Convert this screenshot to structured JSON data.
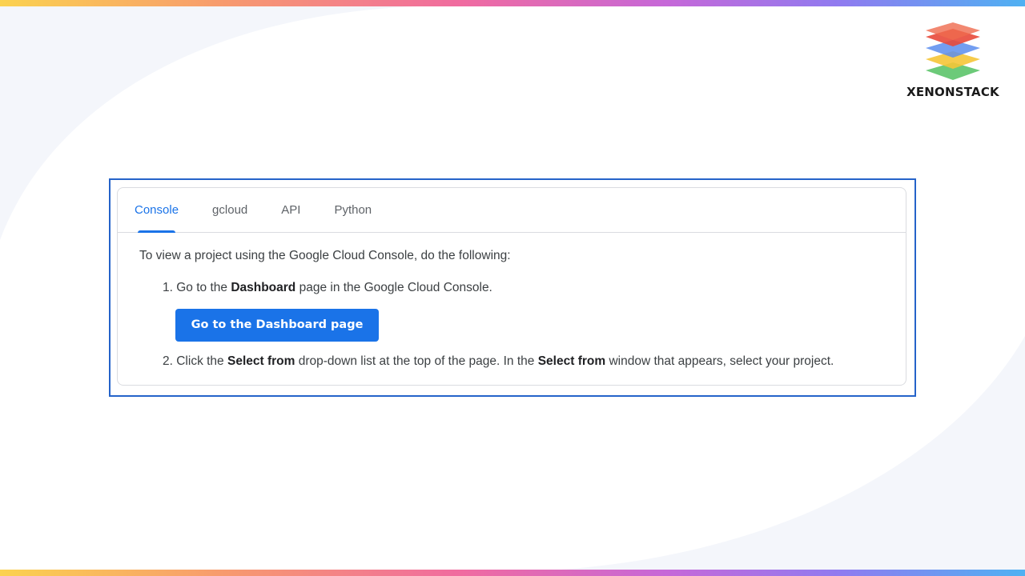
{
  "brand": {
    "name": "XENONSTACK",
    "logo_icon": "layered-stack-logo-icon",
    "layer_colors": [
      "#e8493a",
      "#5b8def",
      "#f5c537",
      "#5cc46a"
    ]
  },
  "decor": {
    "gradient_colors": [
      "#fbd24f",
      "#f79a6e",
      "#f06ba0",
      "#c668d8",
      "#8f7bf0",
      "#4fb1f2"
    ],
    "background_curve_color": "#f4f6fb"
  },
  "tabs": [
    {
      "label": "Console",
      "active": true
    },
    {
      "label": "gcloud",
      "active": false
    },
    {
      "label": "API",
      "active": false
    },
    {
      "label": "Python",
      "active": false
    }
  ],
  "content": {
    "intro": "To view a project using the Google Cloud Console, do the following:",
    "step1": {
      "prefix": "1. Go to the ",
      "bold": "Dashboard",
      "suffix": " page in the Google Cloud Console."
    },
    "button_label": "Go to the Dashboard page",
    "step2": {
      "prefix": "2. Click the ",
      "bold1": "Select from",
      "middle": " drop-down list at the top of the page. In the ",
      "bold2": "Select from",
      "suffix": " window that appears, select your project."
    }
  },
  "colors": {
    "accent": "#1a73e8",
    "frame": "#2563c9"
  }
}
